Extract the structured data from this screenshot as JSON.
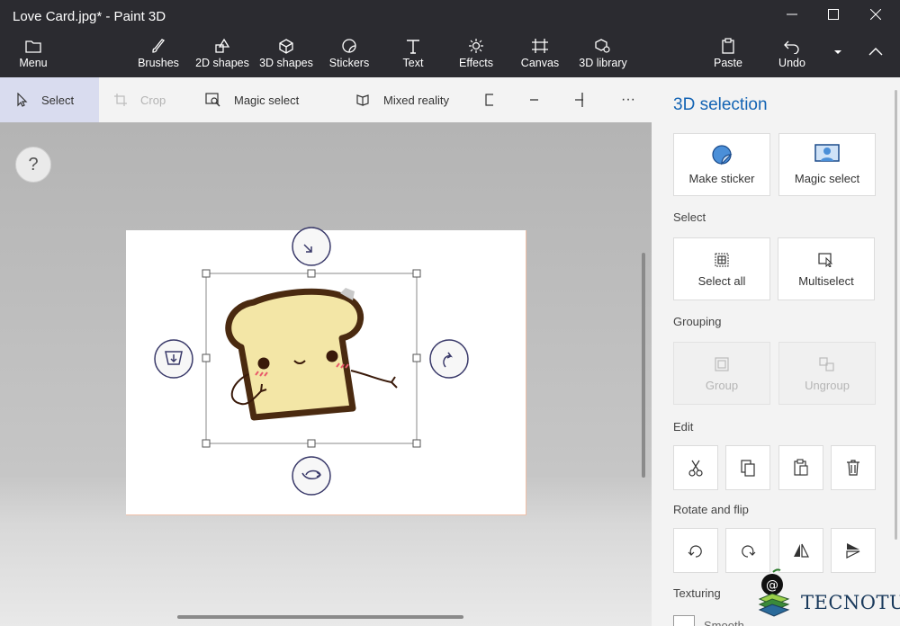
{
  "window": {
    "title": "Love Card.jpg* - Paint 3D"
  },
  "ribbon": {
    "menu": "Menu",
    "brushes": "Brushes",
    "shapes2d": "2D shapes",
    "shapes3d": "3D shapes",
    "stickers": "Stickers",
    "text": "Text",
    "effects": "Effects",
    "canvas": "Canvas",
    "library3d": "3D library",
    "paste": "Paste",
    "undo": "Undo"
  },
  "toolbar": {
    "select": "Select",
    "crop": "Crop",
    "magic_select": "Magic select",
    "mixed_reality": "Mixed reality",
    "more": "···"
  },
  "canvas": {
    "help": "?"
  },
  "panel": {
    "title": "3D selection",
    "make_sticker": "Make sticker",
    "magic_select": "Magic select",
    "select_section": "Select",
    "select_all": "Select all",
    "multiselect": "Multiselect",
    "grouping_section": "Grouping",
    "group": "Group",
    "ungroup": "Ungroup",
    "edit_section": "Edit",
    "rotate_section": "Rotate and flip",
    "texturing_section": "Texturing",
    "smooth": "Smooth"
  },
  "watermark": {
    "text": "TECNOTUTO"
  },
  "colors": {
    "accent": "#1464b4",
    "titlebar": "#2b2b30",
    "toast_fill": "#f3e6a6",
    "toast_outline": "#4a2a10"
  }
}
